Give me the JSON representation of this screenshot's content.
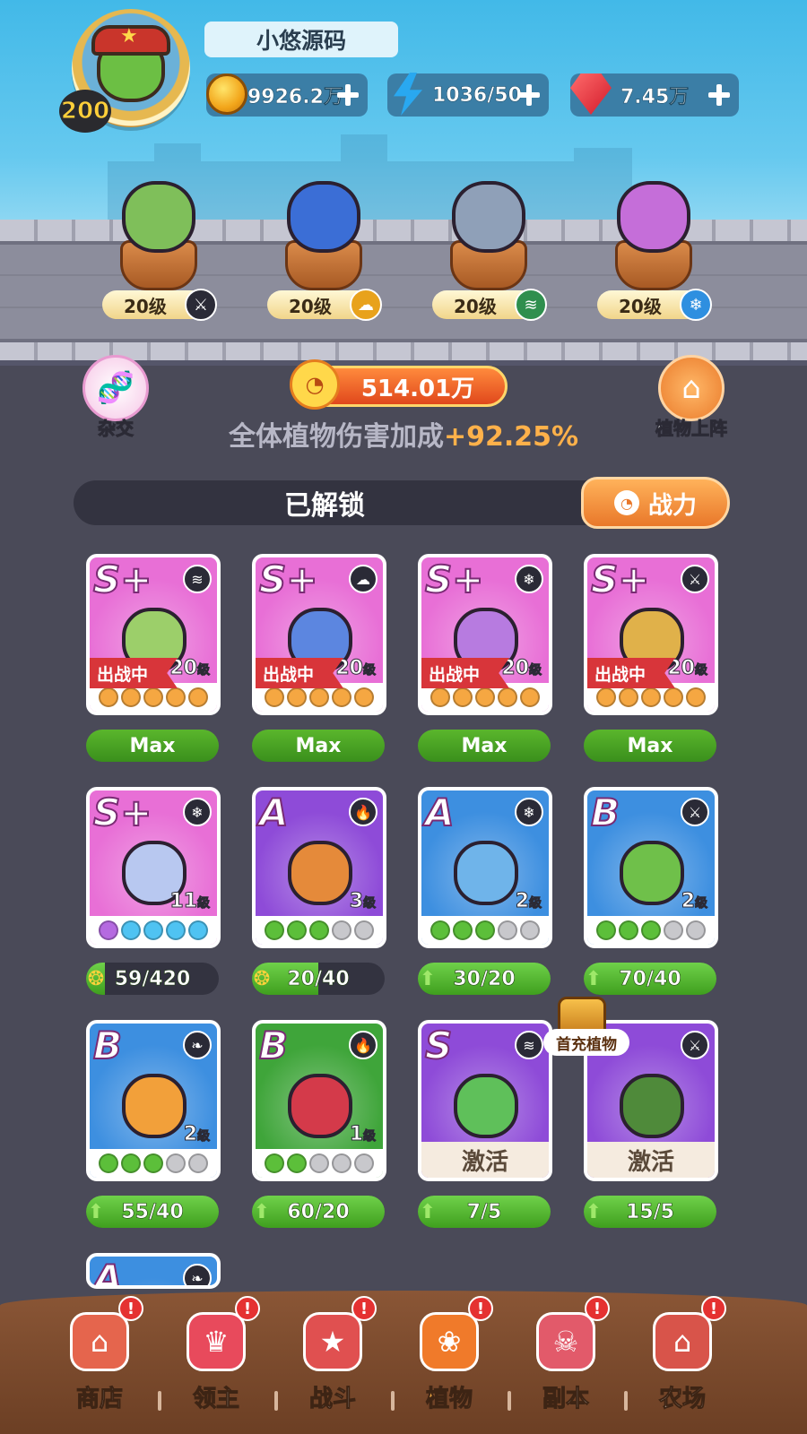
{
  "player": {
    "name": "小悠源码",
    "level": "200"
  },
  "resources": {
    "gold": "9926.2万",
    "energy": "1036/50",
    "gems": "7.45万"
  },
  "deployed": [
    {
      "level": "20级",
      "element": "sword"
    },
    {
      "level": "20级",
      "element": "cloud"
    },
    {
      "level": "20级",
      "element": "wind"
    },
    {
      "level": "20级",
      "element": "ice"
    }
  ],
  "controls": {
    "hybrid_label": "杂交",
    "deploy_label": "植物上阵",
    "power": "514.01万",
    "bonus_text": "全体植物伤害加成",
    "bonus_pct": "+92.25%"
  },
  "section": {
    "title": "已解锁",
    "sort_label": "战力"
  },
  "cards": [
    {
      "rank": "S+",
      "element": "wind",
      "level": "20",
      "deployed": "出战中",
      "bottom": "Max",
      "color": "#e86fd6"
    },
    {
      "rank": "S+",
      "element": "cloud",
      "level": "20",
      "deployed": "出战中",
      "bottom": "Max",
      "color": "#e86fd6"
    },
    {
      "rank": "S+",
      "element": "ice",
      "level": "20",
      "deployed": "出战中",
      "bottom": "Max",
      "color": "#e86fd6"
    },
    {
      "rank": "S+",
      "element": "sword",
      "level": "20",
      "deployed": "出战中",
      "bottom": "Max",
      "color": "#e86fd6"
    },
    {
      "rank": "S+",
      "element": "ice",
      "level": "11",
      "bottom": "59/420",
      "progress": 0.14,
      "color": "#e86fd6"
    },
    {
      "rank": "A",
      "element": "fire",
      "level": "3",
      "bottom": "20/40",
      "progress": 0.5,
      "color": "#8e4bd8"
    },
    {
      "rank": "A",
      "element": "ice",
      "level": "2",
      "bottom": "30/20",
      "progress": 1,
      "color": "#3d8fe0"
    },
    {
      "rank": "B",
      "element": "sword",
      "level": "2",
      "bottom": "70/40",
      "progress": 1,
      "color": "#3d8fe0"
    },
    {
      "rank": "B",
      "element": "leaf",
      "level": "2",
      "bottom": "55/40",
      "progress": 1,
      "color": "#3d8fe0"
    },
    {
      "rank": "B",
      "element": "fire",
      "level": "1",
      "bottom": "60/20",
      "progress": 1,
      "color": "#3fa53a"
    },
    {
      "rank": "S",
      "element": "wind",
      "activate": "激活",
      "bottom": "7/5",
      "progress": 1,
      "color": "#8e4bd8"
    },
    {
      "rank": "",
      "element": "sword",
      "activate": "激活",
      "bottom": "15/5",
      "progress": 1,
      "color": "#8e4bd8"
    },
    {
      "rank": "A",
      "element": "leaf",
      "color": "#3d8fe0"
    }
  ],
  "first_charge_label": "首充植物",
  "nav": [
    {
      "label": "商店",
      "badge": "!"
    },
    {
      "label": "领主",
      "badge": "!"
    },
    {
      "label": "战斗",
      "badge": "!"
    },
    {
      "label": "植物",
      "badge": "!",
      "active": true
    },
    {
      "label": "副本",
      "badge": "!"
    },
    {
      "label": "农场",
      "badge": "!"
    }
  ],
  "element_glyphs": {
    "sword": "⚔",
    "cloud": "☁",
    "wind": "≋",
    "ice": "❄",
    "fire": "🔥",
    "leaf": "❧"
  },
  "colors": {
    "accent": "#f08a2e",
    "progress_green": "#4caf2a",
    "shard_dark": "#2f2f3a"
  }
}
